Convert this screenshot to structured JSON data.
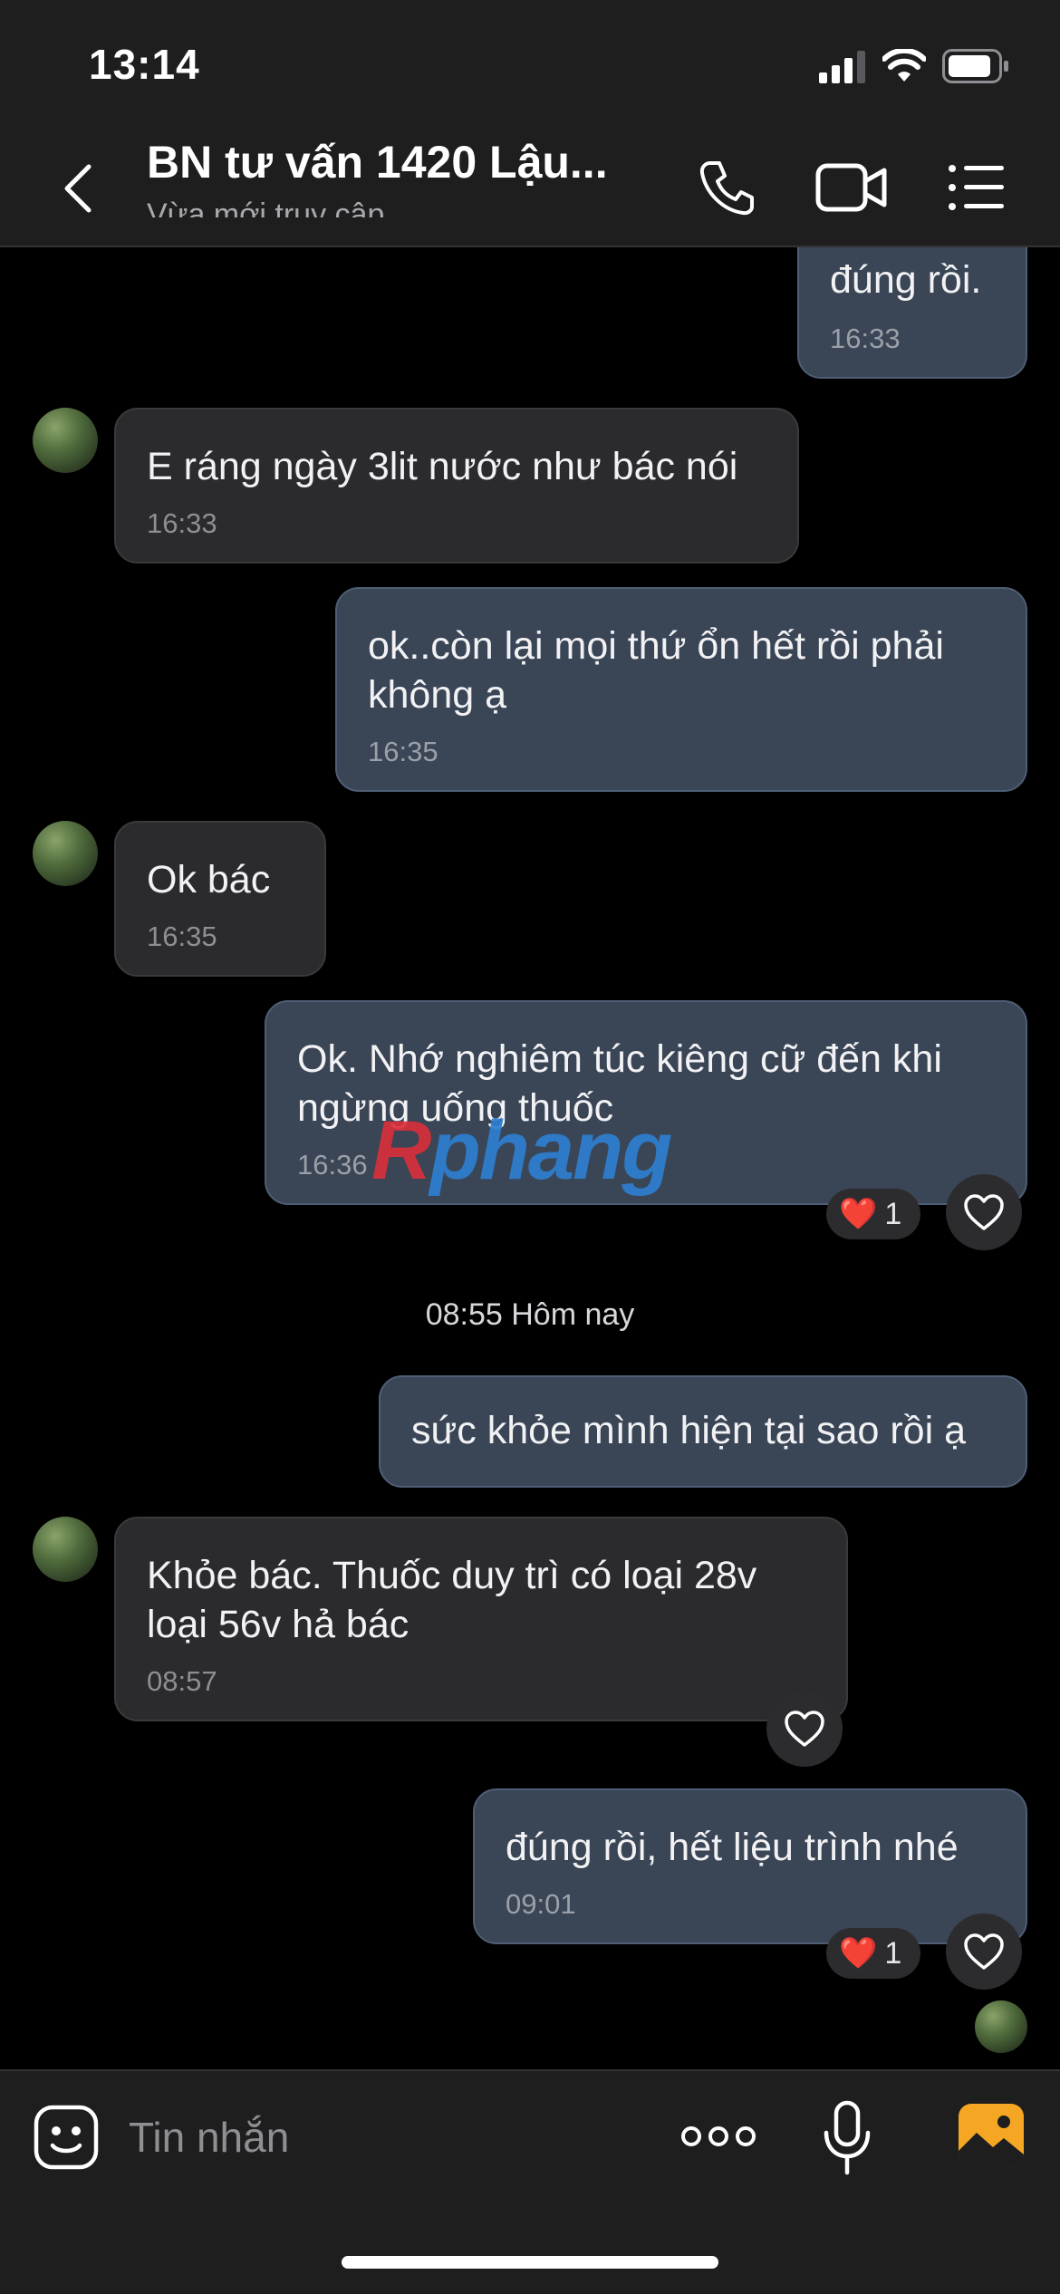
{
  "status_bar": {
    "time": "13:14"
  },
  "header": {
    "title": "BN tư vấn 1420 Lậu...",
    "subtitle": "Vừa mới truy cập"
  },
  "messages": [
    {
      "text": "đúng rồi.",
      "time": "16:33"
    },
    {
      "text": "E ráng ngày 3lit nước như bác nói",
      "time": "16:33"
    },
    {
      "text": "ok..còn lại mọi thứ ổn hết rồi phải\nkhông ạ",
      "time": "16:35"
    },
    {
      "text": "Ok bác",
      "time": "16:35"
    },
    {
      "text": "Ok. Nhớ nghiêm túc kiêng cữ đến khi\nngừng uống thuốc",
      "time": "16:36",
      "reaction": "❤️",
      "reaction_count": "1"
    },
    {
      "text": "sức khỏe mình hiện tại sao rồi ạ"
    },
    {
      "text": "Khỏe bác. Thuốc duy trì có loại 28v\nloại 56v hả bác",
      "time": "08:57"
    },
    {
      "text": "đúng rồi, hết liệu trình nhé",
      "time": "09:01",
      "reaction": "❤️",
      "reaction_count": "1"
    }
  ],
  "date_separator": "08:55 Hôm nay",
  "watermark": {
    "prefix": "R",
    "rest": "phang"
  },
  "composer": {
    "placeholder": "Tin nhắn"
  },
  "colors": {
    "incoming": "#2b2b2d",
    "outgoing": "#3a4556",
    "accent": "#f5a623"
  }
}
